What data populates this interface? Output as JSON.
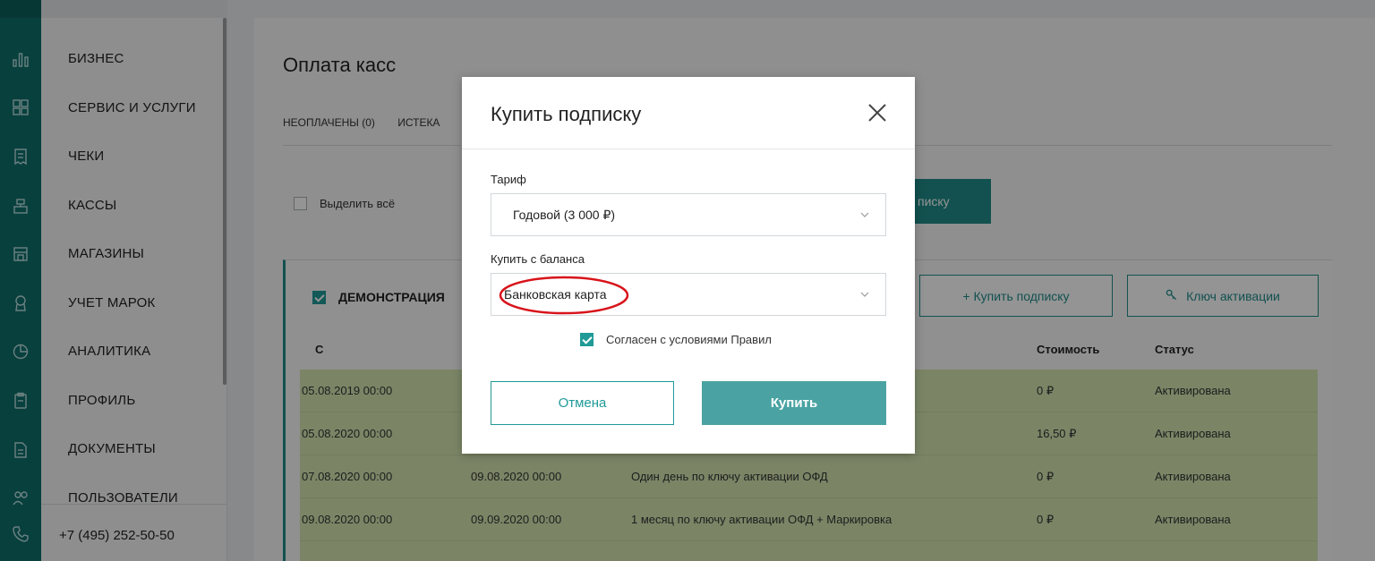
{
  "sidebar": {
    "items": [
      {
        "label": "БИЗНЕС",
        "icon": "bar-chart-icon"
      },
      {
        "label": "СЕРВИС И УСЛУГИ",
        "icon": "grid-icon"
      },
      {
        "label": "ЧЕКИ",
        "icon": "receipt-icon"
      },
      {
        "label": "КАССЫ",
        "icon": "register-icon"
      },
      {
        "label": "МАГАЗИНЫ",
        "icon": "store-icon"
      },
      {
        "label": "УЧЕТ МАРОК",
        "icon": "badge-icon"
      },
      {
        "label": "АНАЛИТИКА",
        "icon": "pie-chart-icon"
      },
      {
        "label": "ПРОФИЛЬ",
        "icon": "clipboard-icon"
      },
      {
        "label": "ДОКУМЕНТЫ",
        "icon": "document-icon"
      },
      {
        "label": "ПОЛЬЗОВАТЕЛИ",
        "icon": "users-icon"
      }
    ],
    "phone": "+7 (495) 252-50-50"
  },
  "main": {
    "title": "Оплата касс",
    "tabs": [
      "НЕОПЛАЧЕНЫ (0)",
      "ИСТЕКА"
    ],
    "select_all": "Выделить всё",
    "pay_button_partial": "писку",
    "panel": {
      "name": "ДЕМОНСТРАЦИЯ",
      "buy_subscription": "+  Купить подписку",
      "activation_key": "Ключ активации",
      "headers": {
        "start": "С",
        "cost": "Стоимость",
        "status": "Статус"
      },
      "rows": [
        {
          "start": "05.08.2019 00:00",
          "end": "",
          "desc": "",
          "cost": "0 ₽",
          "status": "Активирована"
        },
        {
          "start": "05.08.2020 00:00",
          "end": "",
          "desc": "",
          "cost": "16,50 ₽",
          "status": "Активирована"
        },
        {
          "start": "07.08.2020 00:00",
          "end": "09.08.2020 00:00",
          "desc": "Один день по ключу активации ОФД",
          "cost": "0 ₽",
          "status": "Активирована"
        },
        {
          "start": "09.08.2020 00:00",
          "end": "09.09.2020 00:00",
          "desc": "1 месяц по ключу активации ОФД + Маркировка",
          "cost": "0 ₽",
          "status": "Активирована"
        }
      ]
    }
  },
  "modal": {
    "title": "Купить подписку",
    "tariff_label": "Тариф",
    "tariff_value": "Годовой (3 000 ₽)",
    "balance_label": "Купить с баланса",
    "balance_value": "Банковская карта",
    "agree_text": "Согласен с условиями Правил",
    "agree_checked": true,
    "cancel": "Отмена",
    "buy": "Купить"
  },
  "colors": {
    "accent": "#1f8c89",
    "rail": "#0e6e6b",
    "row_green": "#d5e6b0",
    "highlight": "#d8141b"
  }
}
